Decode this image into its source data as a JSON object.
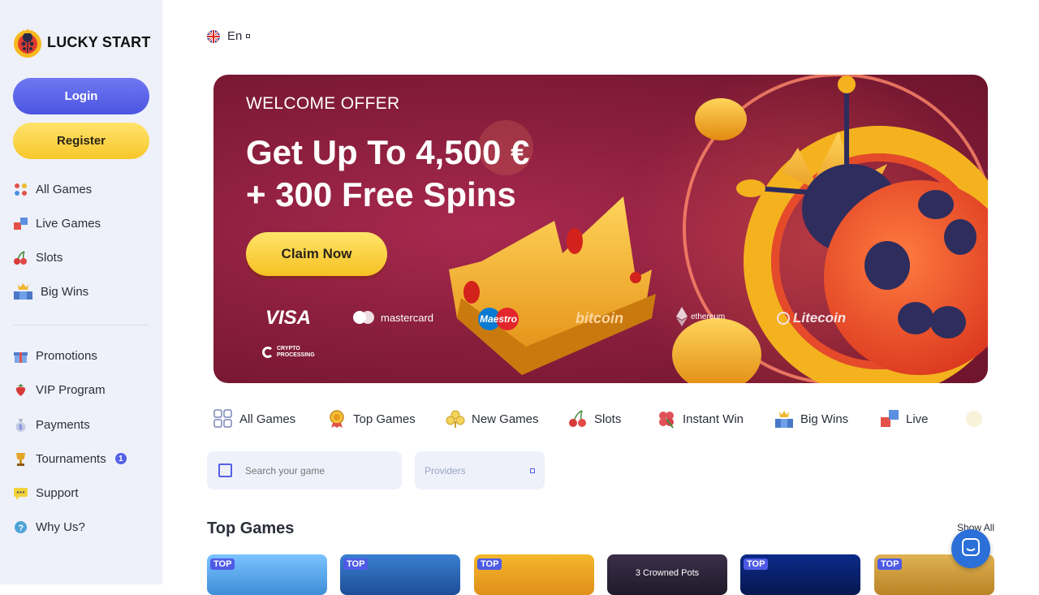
{
  "brand": {
    "name": "LUCKY START"
  },
  "auth": {
    "login_label": "Login",
    "register_label": "Register"
  },
  "sidebar": {
    "primary": [
      {
        "label": "All Games",
        "icon": "dice-icon"
      },
      {
        "label": "Live Games",
        "icon": "live-icon"
      },
      {
        "label": "Slots",
        "icon": "cherry-icon"
      },
      {
        "label": "Big Wins",
        "icon": "trophy-podium-icon"
      }
    ],
    "secondary": [
      {
        "label": "Promotions",
        "icon": "gift-icon"
      },
      {
        "label": "VIP Program",
        "icon": "strawberry-icon"
      },
      {
        "label": "Payments",
        "icon": "money-bag-icon"
      },
      {
        "label": "Tournaments",
        "icon": "cup-icon",
        "badge": "1"
      },
      {
        "label": "Support",
        "icon": "chat-bubble-icon"
      },
      {
        "label": "Why Us?",
        "icon": "question-icon"
      }
    ]
  },
  "language": {
    "label": "En",
    "flag": "uk-flag-icon"
  },
  "hero": {
    "eyebrow": "WELCOME OFFER",
    "title_line1": "Get Up To 4,500 €",
    "title_line2": "+ 300 Free Spins",
    "cta_label": "Claim Now",
    "payment_methods": [
      "VISA",
      "mastercard",
      "Maestro",
      "bitcoin",
      "ethereum",
      "Litecoin",
      "CRYPTO PROCESSING"
    ]
  },
  "categories": [
    {
      "label": "All Games",
      "icon": "grid-icon"
    },
    {
      "label": "Top Games",
      "icon": "medal-icon"
    },
    {
      "label": "New Games",
      "icon": "clover-icon"
    },
    {
      "label": "Slots",
      "icon": "cherry-icon"
    },
    {
      "label": "Instant Win",
      "icon": "four-leaf-clover-icon"
    },
    {
      "label": "Big Wins",
      "icon": "trophy-podium-icon"
    },
    {
      "label": "Live",
      "icon": "live-icon"
    }
  ],
  "search": {
    "placeholder": "Search your game"
  },
  "providers": {
    "label": "Providers"
  },
  "top_games": {
    "title": "Top Games",
    "show_all": "Show All",
    "tiles": [
      {
        "tag": "TOP",
        "text": ""
      },
      {
        "tag": "TOP",
        "text": ""
      },
      {
        "tag": "TOP",
        "text": ""
      },
      {
        "tag": "",
        "text": "3 Crowned Pots"
      },
      {
        "tag": "TOP",
        "text": ""
      },
      {
        "tag": "TOP",
        "text": ""
      }
    ]
  },
  "colors": {
    "accent": "#5560e9",
    "cta_yellow": "#f7c72a",
    "hero_bg": "#8c1f3e",
    "sidebar_bg": "#eef1fa"
  }
}
